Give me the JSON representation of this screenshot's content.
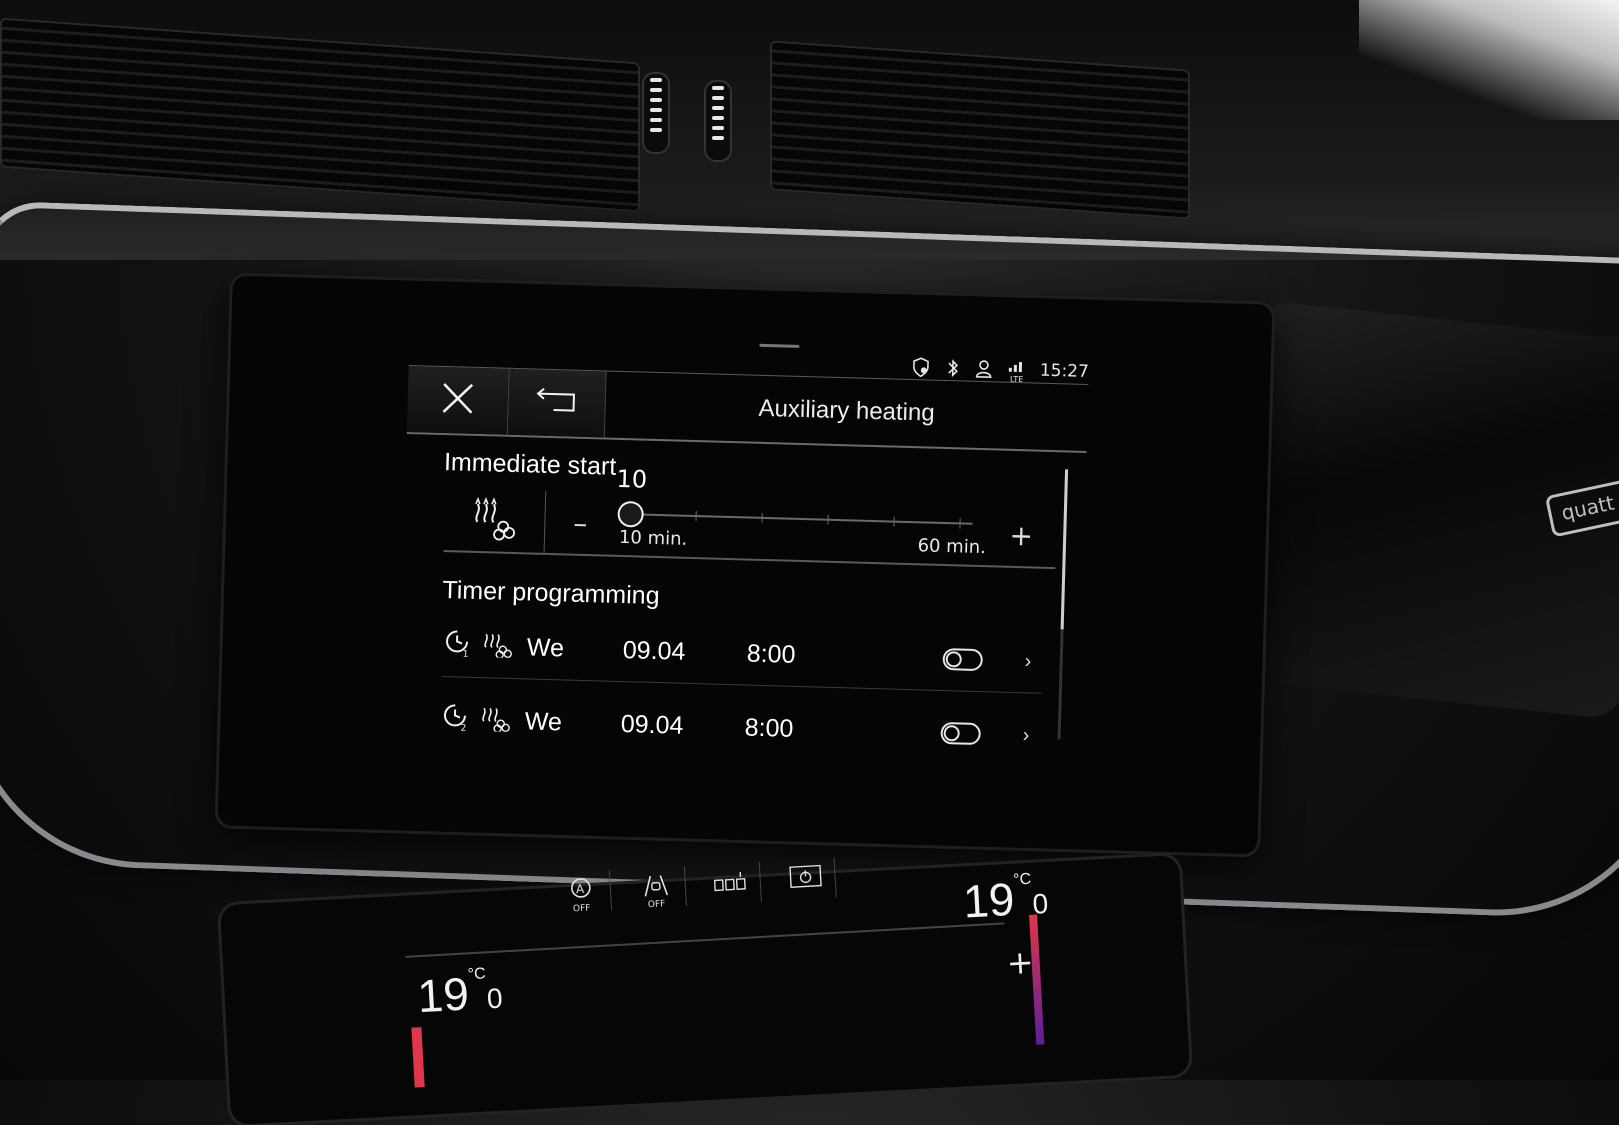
{
  "status_bar": {
    "time": "15:27",
    "icons": [
      "location-shield-icon",
      "bluetooth-icon",
      "user-profile-icon",
      "lte-signal-icon"
    ],
    "lte_label": "LTE"
  },
  "header": {
    "close_icon": "close-icon",
    "back_icon": "back-arrow-icon",
    "title": "Auxiliary heating"
  },
  "immediate_start": {
    "title": "Immediate start",
    "heater_icon": "auxiliary-heater-icon",
    "minus_label": "–",
    "plus_label": "+",
    "slider": {
      "value_label": "10",
      "value": 10,
      "min": 10,
      "max": 60,
      "min_label": "10 min.",
      "max_label": "60 min."
    }
  },
  "timer_programming": {
    "title": "Timer programming",
    "timers": [
      {
        "timer_icon": "timer-1-icon",
        "heater_icon": "auxiliary-heater-icon",
        "timer_number": "1",
        "day": "We",
        "date": "09.04",
        "time": "8:00",
        "enabled": false
      },
      {
        "timer_icon": "timer-2-icon",
        "heater_icon": "auxiliary-heater-icon",
        "timer_number": "2",
        "day": "We",
        "date": "09.04",
        "time": "8:00",
        "enabled": false
      }
    ]
  },
  "climate_panel": {
    "left_temp": "19",
    "left_temp_decimal": "0",
    "right_temp": "19",
    "right_temp_decimal": "0",
    "temp_unit": "°C",
    "icons": [
      "auto-off-icon",
      "lane-assist-off-icon",
      "seat-heating-icon",
      "power-icon"
    ],
    "off_label": "OFF",
    "plus_label": "+"
  },
  "badge_text": "quatt"
}
